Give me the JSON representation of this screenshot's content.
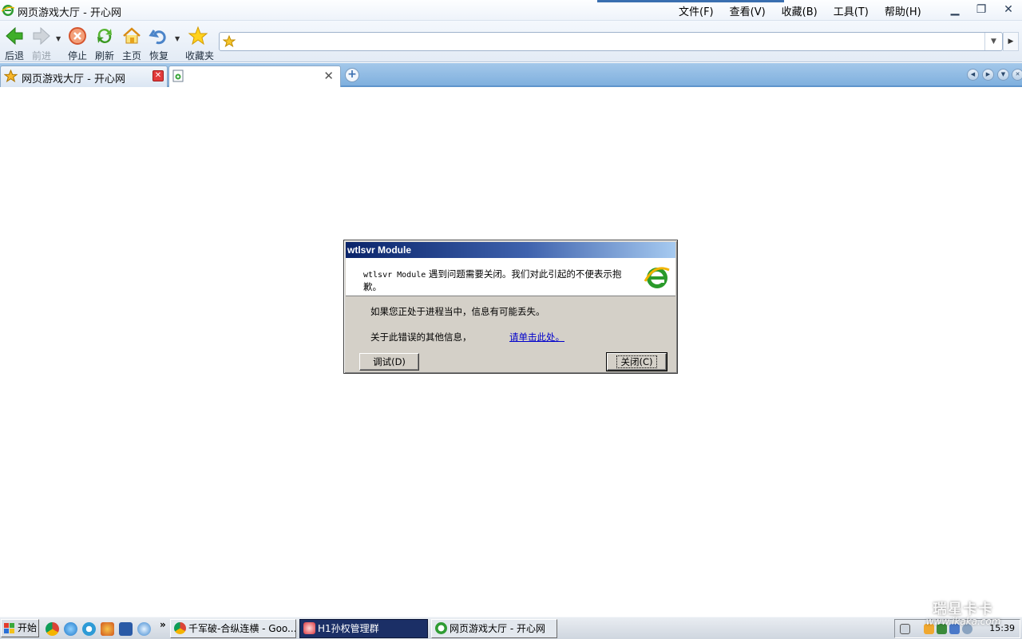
{
  "window": {
    "title": "网页游戏大厅 - 开心网"
  },
  "menu": {
    "file": "文件(F)",
    "view": "查看(V)",
    "favorites": "收藏(B)",
    "tools": "工具(T)",
    "help": "帮助(H)"
  },
  "toolbar": {
    "back": "后退",
    "forward": "前进",
    "stop": "停止",
    "refresh": "刷新",
    "home": "主页",
    "restore": "恢复",
    "favorites": "收藏夹"
  },
  "address": {
    "value": ""
  },
  "tabs": [
    {
      "label": "网页游戏大厅 - 开心网",
      "icon": "star-icon"
    },
    {
      "label": "",
      "icon": "page-icon"
    }
  ],
  "dialog": {
    "title": "wtlsvr Module",
    "message_app": "wtlsvr Module",
    "message_rest": " 遇到问题需要关闭。我们对此引起的不便表示抱歉。",
    "line1": "如果您正处于进程当中，信息有可能丢失。",
    "line2": "关于此错误的其他信息，",
    "link": "请单击此处。",
    "debug_button": "调试(D)",
    "close_button": "关闭(C)"
  },
  "taskbar": {
    "start": "开始",
    "chevron": "»",
    "tasks": [
      {
        "label": "千军破-合纵连横 - Goo...",
        "icon": "chrome-icon"
      },
      {
        "label": "H1孙权管理群",
        "icon": "qq-group-icon"
      },
      {
        "label": "网页游戏大厅 - 开心网",
        "icon": "ie-icon"
      }
    ],
    "clock": "15:39"
  },
  "watermark": {
    "line1": "瑞星卡卡",
    "line2": "www.ikaka.com"
  },
  "colors": {
    "titlebar_blue": "#0a246a",
    "tabbar_blue": "#7fb0de",
    "dialog_gray": "#d4d0c8",
    "link_blue": "#0000cc"
  }
}
